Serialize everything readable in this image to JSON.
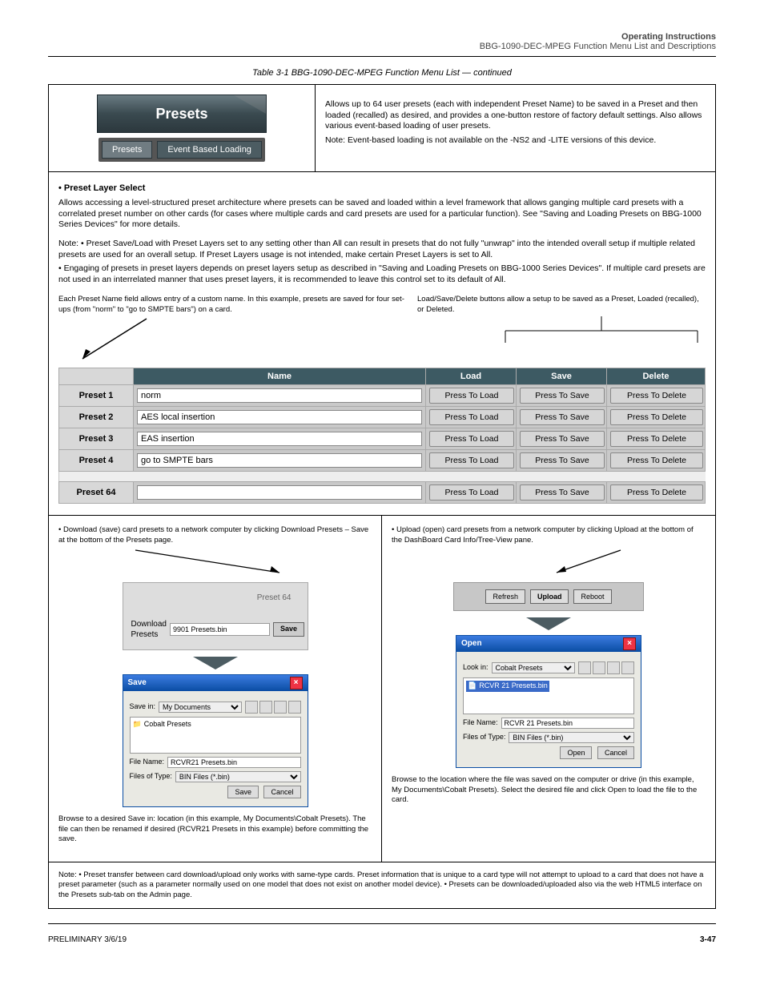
{
  "header": {
    "doc_title": "Operating Instructions",
    "section": "BBG-1090-DEC-MPEG Function Menu List and Descriptions"
  },
  "table_caption": "Table 3-1  BBG-1090-DEC-MPEG Function Menu List — continued",
  "top_left": {
    "badge": "Presets",
    "tabs": [
      "Presets",
      "Event Based Loading"
    ]
  },
  "top_right": {
    "intro": "Allows up to 64 user presets (each with independent Preset Name) to be saved in a Preset and then loaded (recalled) as desired, and provides a one-button restore of factory default settings. Also allows various event-based loading of user presets.",
    "note": "Note: Event-based loading is not available on the -NS2 and -LITE versions of this device."
  },
  "mid": {
    "title": "• Preset Layer Select",
    "para": "Allows accessing a level-structured preset architecture where presets can be saved and loaded within a level framework that allows ganging multiple card presets with a correlated preset number on other cards (for cases where multiple cards and card presets are used for a particular function). See \"Saving and Loading Presets on BBG-1000 Series Devices\" for more details.",
    "notes": [
      "Note: • Preset Save/Load with Preset Layers set to any setting other than All can result in presets that do not fully \"unwrap\" into the intended overall setup if multiple related presets are used for an overall setup. If Preset Layers usage is not intended, make certain Preset Layers is set to All.",
      "• Engaging of presets in preset layers depends on preset layers setup as described in \"Saving and Loading Presets on BBG-1000 Series Devices\". If multiple card presets are not used in an interrelated manner that uses preset layers, it is recommended to leave this control set to its default of All."
    ],
    "callout_left": "Each Preset Name field allows entry of a custom name. In this example, presets are saved for four set-ups (from \"norm\" to \"go to SMPTE bars\") on a card.",
    "callout_right": "Load/Save/Delete buttons allow a setup to be saved as a Preset, Loaded (recalled), or Deleted."
  },
  "presets": {
    "name_header": "Name",
    "load_header": "Load",
    "save_header": "Save",
    "delete_header": "Delete",
    "rows": [
      {
        "idx": "Preset 1",
        "name": "norm"
      },
      {
        "idx": "Preset 2",
        "name": "AES local insertion"
      },
      {
        "idx": "Preset 3",
        "name": "EAS insertion"
      },
      {
        "idx": "Preset 4",
        "name": "go to SMPTE bars"
      },
      {
        "idx": "Preset 64",
        "name": ""
      }
    ],
    "btn_load": "Press To Load",
    "btn_save": "Press To Save",
    "btn_delete": "Press To Delete"
  },
  "bottom_left": {
    "bullet": "• Download (save) card presets to a network computer by clicking Download Presets – Save at the bottom of the Presets page.",
    "panel_label": "Preset 64",
    "dl_label": "Download Presets",
    "dl_file": "9901 Presets.bin",
    "dl_btn": "Save",
    "dlg_title": "Save",
    "save_in": "Save in:",
    "folder": "My Documents",
    "subfolder": "Cobalt Presets",
    "file_name_lbl": "File Name:",
    "file_name": "RCVR21 Presets.bin",
    "file_type_lbl": "Files of Type:",
    "file_type": "BIN Files (*.bin)",
    "btn_save": "Save",
    "btn_cancel": "Cancel"
  },
  "bottom_right": {
    "bullet": "• Upload (open) card presets from a network computer by clicking Upload at the bottom of the DashBoard Card Info/Tree-View pane.",
    "bar_btns": [
      "Refresh",
      "Upload",
      "Reboot"
    ],
    "dlg_title": "Open",
    "look_in": "Look in:",
    "folder": "Cobalt Presets",
    "file_item": "RCVR 21 Presets.bin",
    "file_name_lbl": "File Name:",
    "file_name": "RCVR 21 Presets.bin",
    "file_type_lbl": "Files of Type:",
    "file_type": "BIN Files (*.bin)",
    "btn_open": "Open",
    "btn_cancel": "Cancel"
  },
  "bottom_note": "Browse to a desired Save in: location (in this example, My Documents\\Cobalt Presets). The file can then be renamed if desired (RCVR21 Presets in this example) before committing the save.",
  "bottom_note_right": "Browse to the location where the file was saved on the computer or drive (in this example, My Documents\\Cobalt Presets). Select the desired file and click Open to load the file to the card.",
  "final_note": "Note: • Preset transfer between card download/upload only works with same-type cards. Preset information that is unique to a card type will not attempt to upload to a card that does not have a preset parameter (such as a parameter normally used on one model that does not exist on another model device).\n• Presets can be downloaded/uploaded also via the web HTML5 interface on the Presets sub-tab on the Admin page.",
  "footer": {
    "rev": "PRELIMINARY 3/6/19",
    "pn": "3-47"
  }
}
